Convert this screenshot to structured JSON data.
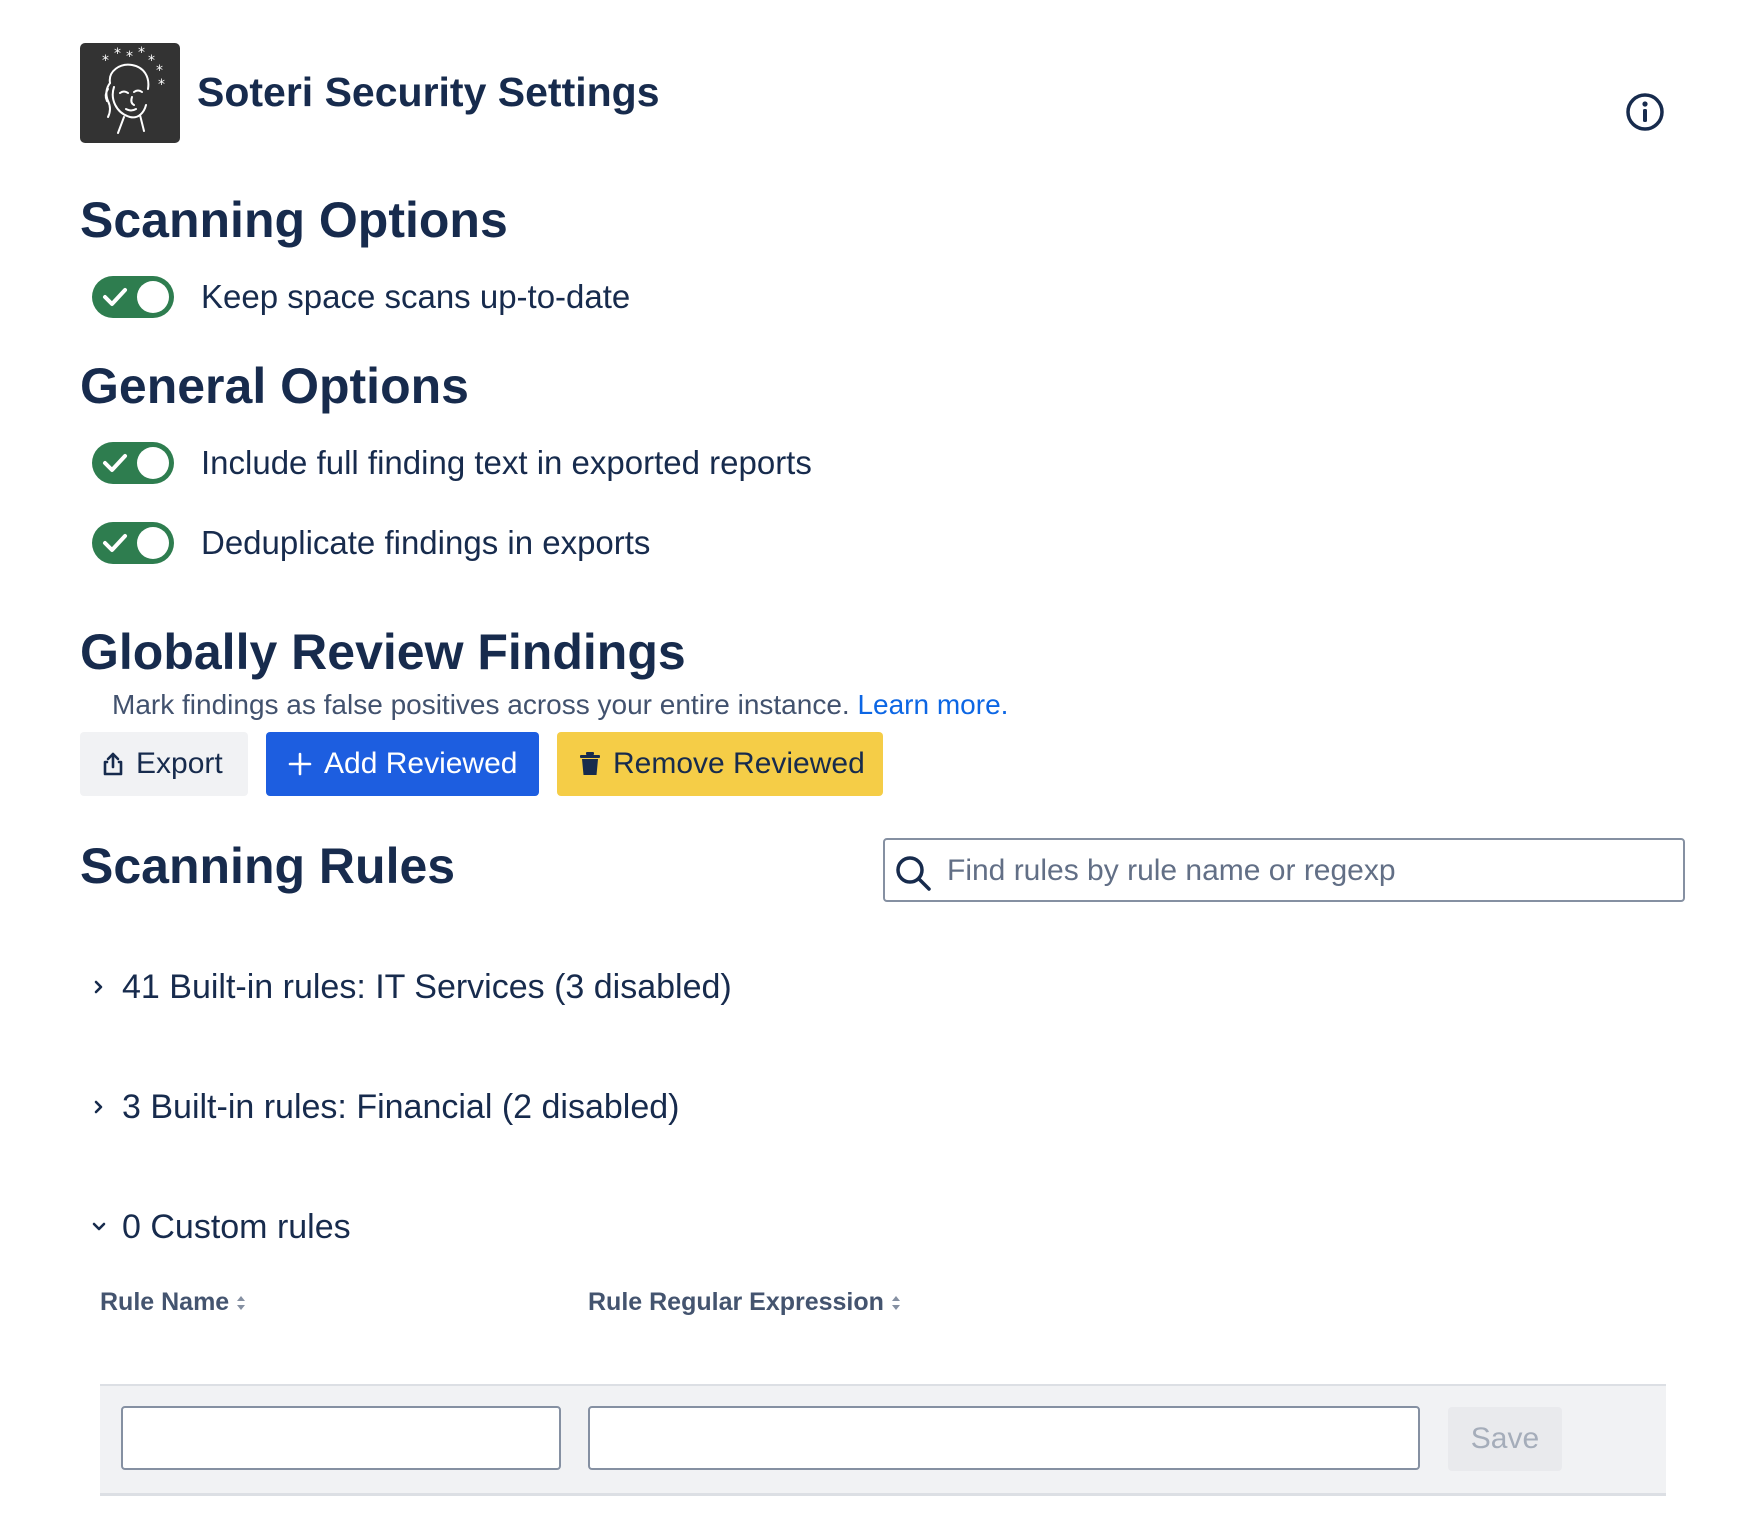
{
  "header": {
    "title": "Soteri Security Settings",
    "logo_icon": "soteri-face-logo-icon",
    "info_icon": "info-icon"
  },
  "scanning_options": {
    "heading": "Scanning Options",
    "toggles": [
      {
        "label": "Keep space scans up-to-date",
        "checked": true
      }
    ]
  },
  "general_options": {
    "heading": "General Options",
    "toggles": [
      {
        "label": "Include full finding text in exported reports",
        "checked": true
      },
      {
        "label": "Deduplicate findings in exports",
        "checked": true
      }
    ]
  },
  "global_review": {
    "heading": "Globally Review Findings",
    "description": "Mark findings as false positives across your entire instance.",
    "learn_more": "Learn more.",
    "buttons": {
      "export": "Export",
      "add": "Add Reviewed",
      "remove": "Remove Reviewed"
    }
  },
  "scanning_rules": {
    "heading": "Scanning Rules",
    "search_placeholder": "Find rules by rule name or regexp",
    "groups": [
      {
        "label": "41 Built-in rules: IT Services (3 disabled)",
        "expanded": false
      },
      {
        "label": "3 Built-in rules: Financial (2 disabled)",
        "expanded": false
      },
      {
        "label": "0 Custom rules",
        "expanded": true
      }
    ],
    "table": {
      "columns": [
        "Rule Name",
        "Rule Regular Expression"
      ],
      "new_row": {
        "rule_name": "",
        "rule_regex": ""
      },
      "save_label": "Save"
    }
  },
  "colors": {
    "text": "#172b4d",
    "toggle_on": "#2e7d4f",
    "primary": "#1d5ee0",
    "warning": "#f5cd47",
    "link": "#0c66e4"
  }
}
